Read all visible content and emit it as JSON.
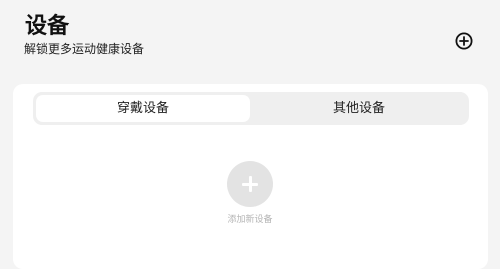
{
  "header": {
    "title": "设备",
    "subtitle": "解锁更多运动健康设备",
    "add_icon": "plus-circle-icon"
  },
  "tabs": [
    {
      "label": "穿戴设备",
      "selected": true
    },
    {
      "label": "其他设备",
      "selected": false
    }
  ],
  "empty_state": {
    "add_icon": "plus-icon",
    "add_label": "添加新设备"
  },
  "colors": {
    "page_background": "#f4f4f4",
    "card_background": "#ffffff",
    "tab_track": "#efefef",
    "add_circle": "#e3e3e3",
    "muted_text": "#b5b5b5"
  }
}
